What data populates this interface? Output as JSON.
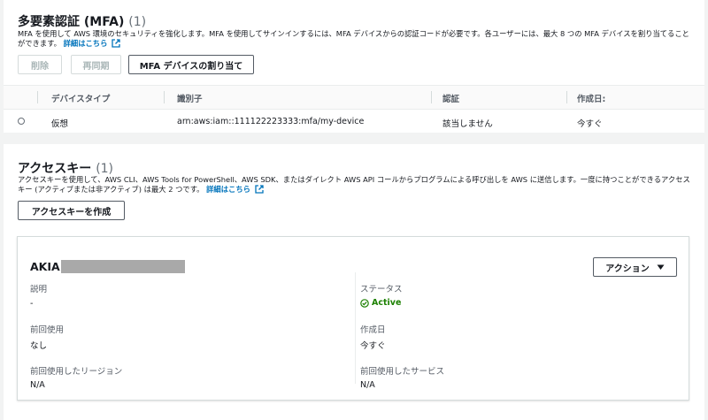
{
  "mfa": {
    "title": "多要素認証 (MFA)",
    "count": "(1)",
    "description": "MFA を使用して AWS 環境のセキュリティを強化します。MFA を使用してサインインするには、MFA デバイスからの認証コードが必要です。各ユーザーには、最大 8 つの MFA デバイスを割り当てることができます。",
    "details_link": "詳細はこちら",
    "buttons": {
      "delete": "削除",
      "resync": "再同期",
      "assign": "MFA デバイスの割り当て"
    },
    "columns": [
      "デバイスタイプ",
      "識別子",
      "認証",
      "作成日:"
    ],
    "rows": [
      {
        "device_type": "仮想",
        "identifier": "arn:aws:iam::111122223333:mfa/my-device",
        "auth": "該当しません",
        "created": "今すぐ"
      }
    ]
  },
  "access_keys": {
    "title": "アクセスキー",
    "count": "(1)",
    "description": "アクセスキーを使用して、AWS CLI、AWS Tools for PowerShell、AWS SDK、またはダイレクト AWS API コールからプログラムによる呼び出しを AWS に送信します。一度に持つことができるアクセスキー (アクティブまたは非アクティブ) は最大 2 つです。",
    "details_link": "詳細はこちら",
    "create_button": "アクセスキーを作成",
    "key": {
      "id_prefix": "AKIA",
      "actions_button": "アクション",
      "description_label": "説明",
      "description_value": "-",
      "status_label": "ステータス",
      "status_value": "Active",
      "last_used_label": "前回使用",
      "last_used_value": "なし",
      "created_label": "作成日",
      "created_value": "今すぐ",
      "last_region_label": "前回使用したリージョン",
      "last_region_value": "N/A",
      "last_service_label": "前回使用したサービス",
      "last_service_value": "N/A"
    }
  },
  "colors": {
    "link": "#0073bb",
    "success": "#1d8102",
    "border": "#d5dbdb"
  }
}
